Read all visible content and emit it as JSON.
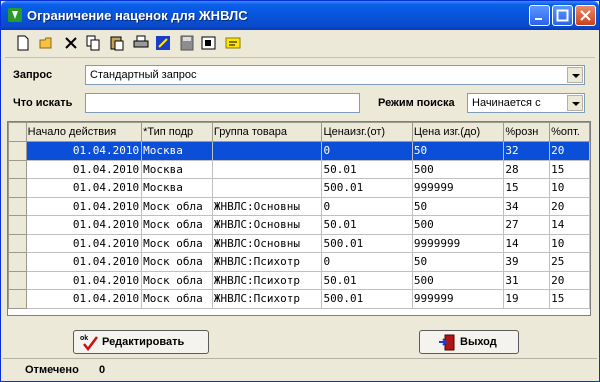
{
  "window": {
    "title": "Ограничение наценок для ЖНВЛС"
  },
  "toolbar": {
    "icons": [
      "new-doc-icon",
      "open-folder-icon",
      "delete-icon",
      "copy-icon",
      "paste-icon",
      "print-icon",
      "edit-icon",
      "disk-icon",
      "filter-icon",
      "note-icon"
    ]
  },
  "query": {
    "label": "Запрос",
    "value": "Стандартный запрос"
  },
  "search": {
    "label": "Что искать",
    "value": "",
    "mode_label": "Режим поиска",
    "mode_value": "Начинается с"
  },
  "table": {
    "headers": [
      "Начало действия",
      "*Тип подр",
      "Группа товара",
      "Ценаизг.(от)",
      "Цена изг.(до)",
      "%розн",
      "%опт."
    ],
    "rows": [
      [
        "01.04.2010",
        "Москва",
        "",
        "0",
        "50",
        "32",
        "20"
      ],
      [
        "01.04.2010",
        "Москва",
        "",
        "50.01",
        "500",
        "28",
        "15"
      ],
      [
        "01.04.2010",
        "Москва",
        "",
        "500.01",
        "999999",
        "15",
        "10"
      ],
      [
        "01.04.2010",
        "Моск обла",
        "ЖНВЛС:Основны",
        "0",
        "50",
        "34",
        "20"
      ],
      [
        "01.04.2010",
        "Моск обла",
        "ЖНВЛС:Основны",
        "50.01",
        "500",
        "27",
        "14"
      ],
      [
        "01.04.2010",
        "Моск обла",
        "ЖНВЛС:Основны",
        "500.01",
        "9999999",
        "14",
        "10"
      ],
      [
        "01.04.2010",
        "Моск обла",
        "ЖНВЛС:Психотр",
        "0",
        "50",
        "39",
        "25"
      ],
      [
        "01.04.2010",
        "Моск обла",
        "ЖНВЛС:Психотр",
        "50.01",
        "500",
        "31",
        "20"
      ],
      [
        "01.04.2010",
        "Моск обла",
        "ЖНВЛС:Психотр",
        "500.01",
        "999999",
        "19",
        "15"
      ]
    ],
    "selected_row": 0
  },
  "buttons": {
    "edit": "Редактировать",
    "exit": "Выход"
  },
  "status": {
    "label": "Отмечено",
    "value": "0"
  }
}
